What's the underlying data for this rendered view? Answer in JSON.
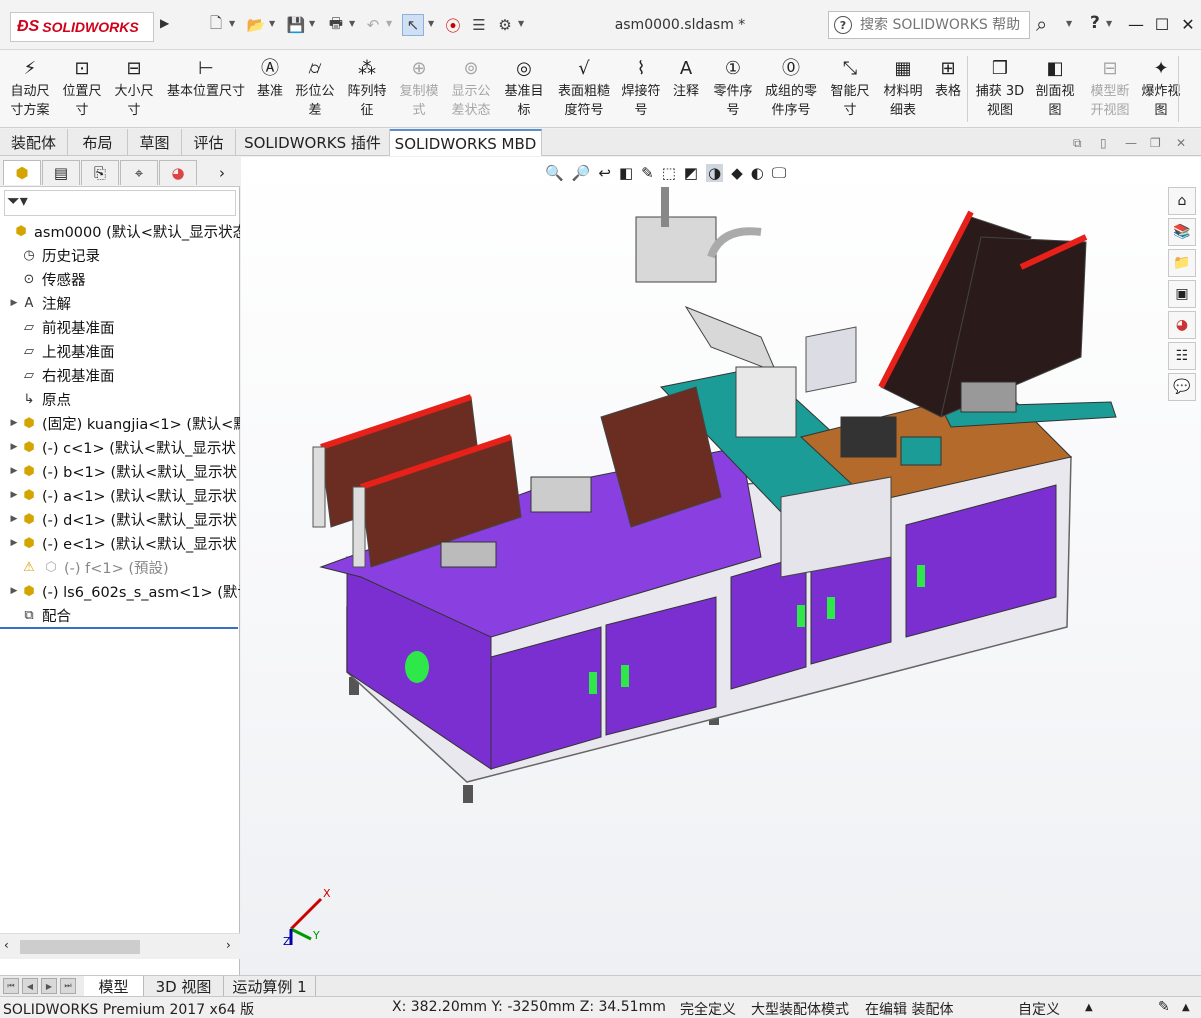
{
  "app": {
    "brand": "SOLIDWORKS",
    "doc_title": "asm0000.sldasm *",
    "help_placeholder": "搜索 SOLIDWORKS 帮助",
    "help_q": "?"
  },
  "ribbon": {
    "items": [
      {
        "label1": "自动尺",
        "label2": "寸方案",
        "icon": "auto-dimension-icon",
        "enabled": true
      },
      {
        "label1": "位置尺",
        "label2": "寸",
        "icon": "location-dimension-icon",
        "enabled": true
      },
      {
        "label1": "大小尺",
        "label2": "寸",
        "icon": "size-dimension-icon",
        "enabled": true
      },
      {
        "label1": "基本位置尺寸",
        "label2": "",
        "icon": "basic-location-dimension-icon",
        "enabled": true
      },
      {
        "label1": "基准",
        "label2": "",
        "icon": "datum-icon",
        "enabled": true
      },
      {
        "label1": "形位公",
        "label2": "差",
        "icon": "geometric-tolerance-icon",
        "enabled": true
      },
      {
        "label1": "阵列特",
        "label2": "征",
        "icon": "pattern-feature-icon",
        "enabled": true
      },
      {
        "label1": "复制模",
        "label2": "式",
        "icon": "copy-scheme-icon",
        "enabled": false
      },
      {
        "label1": "显示公",
        "label2": "差状态",
        "icon": "tolerance-status-icon",
        "enabled": false
      },
      {
        "label1": "基准目",
        "label2": "标",
        "icon": "datum-target-icon",
        "enabled": true
      },
      {
        "label1": "表面粗糙",
        "label2": "度符号",
        "icon": "surface-finish-icon",
        "enabled": true
      },
      {
        "label1": "焊接符",
        "label2": "号",
        "icon": "weld-symbol-icon",
        "enabled": true
      },
      {
        "label1": "注释",
        "label2": "",
        "icon": "note-icon",
        "enabled": true
      },
      {
        "label1": "零件序",
        "label2": "号",
        "icon": "balloon-icon",
        "enabled": true
      },
      {
        "label1": "成组的零",
        "label2": "件序号",
        "icon": "stacked-balloon-icon",
        "enabled": true
      },
      {
        "label1": "智能尺",
        "label2": "寸",
        "icon": "smart-dimension-icon",
        "enabled": true
      },
      {
        "label1": "材料明",
        "label2": "细表",
        "icon": "bom-icon",
        "enabled": true
      },
      {
        "label1": "表格",
        "label2": "",
        "icon": "table-icon",
        "enabled": true
      },
      {
        "label1": "捕获 3D",
        "label2": "视图",
        "icon": "capture-3d-view-icon",
        "enabled": true
      },
      {
        "label1": "剖面视",
        "label2": "图",
        "icon": "section-view-icon",
        "enabled": true
      },
      {
        "label1": "模型断",
        "label2": "开视图",
        "icon": "model-break-view-icon",
        "enabled": false
      },
      {
        "label1": "爆炸视",
        "label2": "图",
        "icon": "exploded-view-icon",
        "enabled": true
      }
    ]
  },
  "tabs": [
    "装配体",
    "布局",
    "草图",
    "评估",
    "SOLIDWORKS 插件",
    "SOLIDWORKS MBD"
  ],
  "tree": [
    {
      "label": "asm0000  (默认<默认_显示状态",
      "icon": "assembly-icon",
      "arrow": false,
      "indent": 0
    },
    {
      "label": "历史记录",
      "icon": "history-icon",
      "arrow": false,
      "indent": 1
    },
    {
      "label": "传感器",
      "icon": "sensor-icon",
      "arrow": false,
      "indent": 1
    },
    {
      "label": "注解",
      "icon": "annotation-icon",
      "arrow": true,
      "indent": 1
    },
    {
      "label": "前视基准面",
      "icon": "plane-icon",
      "arrow": false,
      "indent": 1
    },
    {
      "label": "上视基准面",
      "icon": "plane-icon",
      "arrow": false,
      "indent": 1
    },
    {
      "label": "右视基准面",
      "icon": "plane-icon",
      "arrow": false,
      "indent": 1
    },
    {
      "label": "原点",
      "icon": "origin-icon",
      "arrow": false,
      "indent": 1
    },
    {
      "label": "(固定) kuangjia<1> (默认<默",
      "icon": "component-icon",
      "arrow": true,
      "indent": 1
    },
    {
      "label": "(-) c<1> (默认<默认_显示状",
      "icon": "component-icon",
      "arrow": true,
      "indent": 1
    },
    {
      "label": "(-) b<1> (默认<默认_显示状",
      "icon": "component-icon",
      "arrow": true,
      "indent": 1
    },
    {
      "label": "(-) a<1> (默认<默认_显示状",
      "icon": "component-icon",
      "arrow": true,
      "indent": 1
    },
    {
      "label": "(-) d<1> (默认<默认_显示状",
      "icon": "component-icon",
      "arrow": true,
      "indent": 1
    },
    {
      "label": "(-) e<1> (默认<默认_显示状",
      "icon": "component-icon",
      "arrow": true,
      "indent": 1
    },
    {
      "label": "(-) f<1> (預設)",
      "icon": "suppressed-component-icon",
      "arrow": false,
      "indent": 1,
      "gray": true,
      "warn": true
    },
    {
      "label": "(-) ls6_602s_s_asm<1> (默认",
      "icon": "component-icon",
      "arrow": true,
      "indent": 1
    },
    {
      "label": "配合",
      "icon": "mates-icon",
      "arrow": false,
      "indent": 1
    }
  ],
  "bottom_tabs": [
    "模型",
    "3D 视图",
    "运动算例 1"
  ],
  "status": {
    "product": "SOLIDWORKS Premium 2017 x64 版",
    "coords": "X: 382.20mm Y: -3250mm Z: 34.51mm",
    "defined": "完全定义",
    "mode": "大型装配体模式",
    "editing": "在编辑 装配体",
    "custom": "自定义"
  },
  "triad": {
    "x": "X",
    "y": "Y",
    "z": "Z"
  },
  "colors": {
    "accent": "#5a8fd0",
    "brand": "#d0021b",
    "cabinet": "#7b2fd0",
    "teal": "#2aa198",
    "red": "#e8201a"
  }
}
